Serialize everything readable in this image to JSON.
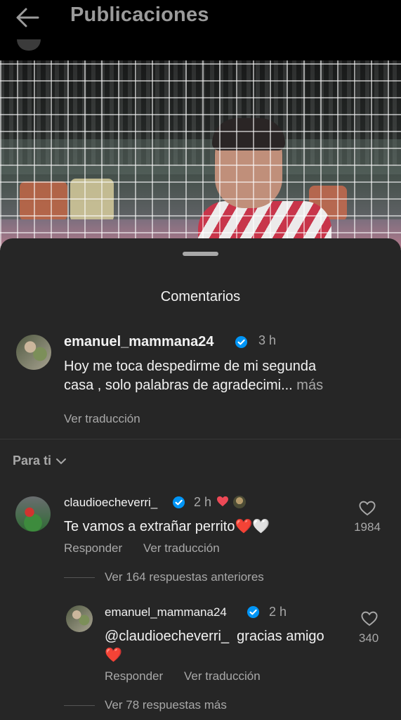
{
  "header": {
    "title": "Publicaciones"
  },
  "sheet": {
    "title": "Comentarios"
  },
  "caption": {
    "username": "emanuel_mammana24",
    "time": "3 h",
    "text_line1": "Hoy me toca despedirme de mi segunda",
    "text_line2": "casa , solo palabras de agradecimi...",
    "more_label": "más",
    "translate_label": "Ver traducción"
  },
  "filter": {
    "label": "Para ti"
  },
  "comments": [
    {
      "username": "claudioecheverri_",
      "time": "2 h",
      "text": "Te vamos a extrañar perrito",
      "emoji": "❤️🤍",
      "likes": "1984",
      "reply_label": "Responder",
      "translate_label": "Ver traducción",
      "view_replies_label": "Ver 164 respuestas anteriores"
    }
  ],
  "reply": {
    "username": "emanuel_mammana24",
    "time": "2 h",
    "text_line1": "@claudioecheverri_  gracias amigo",
    "emoji": "❤️",
    "likes": "340",
    "reply_label": "Responder",
    "translate_label": "Ver traducción",
    "more_replies_label": "Ver 78 respuestas más"
  },
  "colors": {
    "background": "#000000",
    "sheet": "#262626",
    "verified": "#0095f6",
    "heart": "#ed4956",
    "muted": "#a8a8a8"
  },
  "icons": [
    "back-arrow-icon",
    "verified-badge-icon",
    "heart-outline-icon",
    "chevron-down-icon",
    "red-heart-icon"
  ]
}
